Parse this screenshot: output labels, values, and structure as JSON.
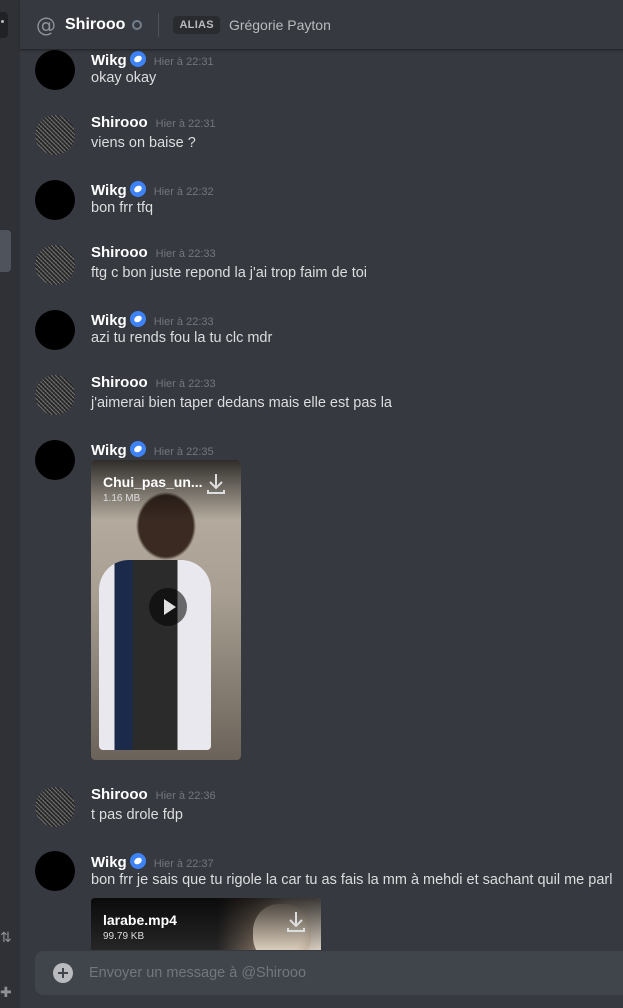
{
  "header": {
    "at_icon": "@",
    "name": "Shirooo",
    "alias_badge": "ALIAS",
    "alias_name": "Grégorie Payton"
  },
  "messages": [
    {
      "author": "Wikg",
      "badge": "blue-badge-icon",
      "avatar": "black",
      "time": "Hier à 22:31",
      "text": "okay okay"
    },
    {
      "author": "Shirooo",
      "avatar": "pattern",
      "time": "Hier à 22:31",
      "text": "viens on baise ?"
    },
    {
      "author": "Wikg",
      "badge": "blue-badge-icon",
      "avatar": "black",
      "time": "Hier à 22:32",
      "text": "bon frr tfq"
    },
    {
      "author": "Shirooo",
      "avatar": "pattern",
      "time": "Hier à 22:33",
      "text": "ftg c bon juste repond la j'ai trop faim de toi"
    },
    {
      "author": "Wikg",
      "badge": "blue-badge-icon",
      "avatar": "black",
      "time": "Hier à 22:33",
      "text": "azi tu rends fou la tu clc mdr"
    },
    {
      "author": "Shirooo",
      "avatar": "pattern",
      "time": "Hier à 22:33",
      "text": "j'aimerai bien taper dedans mais elle est pas la"
    },
    {
      "author": "Wikg",
      "badge": "blue-badge-icon",
      "avatar": "black",
      "time": "Hier à 22:35",
      "attachment": {
        "name": "Chui_pas_un...",
        "size": "1.16 MB"
      }
    },
    {
      "author": "Shirooo",
      "avatar": "pattern",
      "time": "Hier à 22:36",
      "text": "t pas drole fdp"
    },
    {
      "author": "Wikg",
      "badge": "blue-badge-icon",
      "avatar": "black",
      "time": "Hier à 22:37",
      "text": "bon frr je sais que tu rigole la car tu as fais la mm à mehdi et sachant quil me parl",
      "attachment": {
        "name": "larabe.mp4",
        "size": "99.79 KB"
      }
    }
  ],
  "composer": {
    "placeholder": "Envoyer un message à @Shirooo"
  },
  "colors": {
    "background": "#36393f",
    "badge_blue": "#3e82f7",
    "timestamp": "#72767d"
  }
}
